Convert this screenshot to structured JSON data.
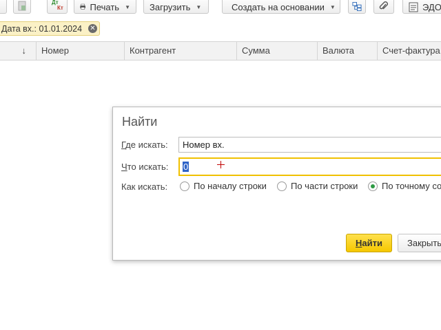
{
  "toolbar": {
    "print_label": "Печать",
    "load_label": "Загрузить",
    "create_based_label": "Создать на основании",
    "edo_label": "ЭДО",
    "dtkt_dt": "Дт",
    "dtkt_kt": "Кт"
  },
  "filter": {
    "chip_text": "Дата вх.: 01.01.2024"
  },
  "table": {
    "sort_indicator": "↓",
    "columns": [
      "Номер",
      "Контрагент",
      "Сумма",
      "Валюта",
      "Счет-фактура"
    ]
  },
  "dialog": {
    "title": "Найти",
    "where_label_first": "Г",
    "where_label_rest": "де искать:",
    "where_value": "Номер вх.",
    "what_label_first": "Ч",
    "what_label_rest": "то искать:",
    "what_value": "0",
    "how_label": "Как искать:",
    "options": [
      "По началу строки",
      "По части строки",
      "По точному со"
    ],
    "selected_option_index": 2,
    "find_button_first": "Н",
    "find_button_rest": "айти",
    "close_button": "Закрыть"
  },
  "colors": {
    "accent_yellow": "#f5c800",
    "radio_selected": "#2e9a44",
    "text_selection": "#2f63c8",
    "filter_chip_bg": "#fbf1c6"
  }
}
